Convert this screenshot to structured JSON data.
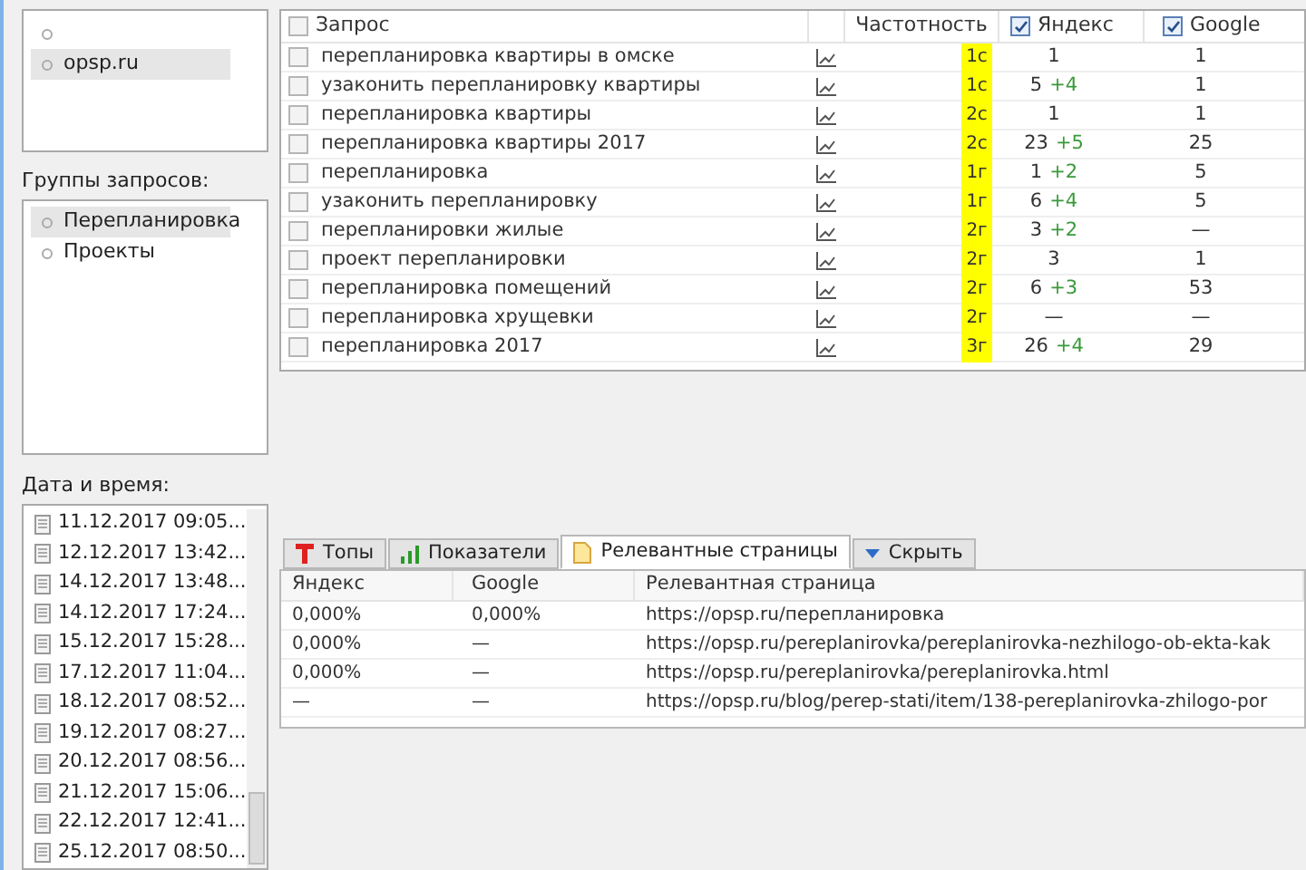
{
  "projects": {
    "items": [
      {
        "selected": false
      },
      {
        "label": "opsp.ru",
        "selected": true
      }
    ]
  },
  "groups": {
    "label": "Группы запросов:",
    "items": [
      {
        "label": "Перепланировка",
        "selected": true
      },
      {
        "label": "Проекты",
        "selected": false
      }
    ]
  },
  "dates": {
    "label": "Дата и время:",
    "items": [
      "11.12.2017 09:05...",
      "12.12.2017 13:42...",
      "14.12.2017 13:48...",
      "14.12.2017 17:24...",
      "15.12.2017 15:28...",
      "17.12.2017 11:04...",
      "18.12.2017 08:52...",
      "19.12.2017 08:27...",
      "20.12.2017 08:56...",
      "21.12.2017 15:06...",
      "22.12.2017 12:41...",
      "25.12.2017 08:50..."
    ]
  },
  "queries": {
    "columns": [
      {
        "label": "Запрос",
        "kind": "checkbox",
        "checked": false
      },
      {
        "label": "Частотность",
        "kind": "plain"
      },
      {
        "label": "Яндекс",
        "kind": "checkbox",
        "checked": true
      },
      {
        "label": "Google",
        "kind": "checkbox",
        "checked": true
      }
    ],
    "rows": [
      {
        "query": "перепланировка квартиры в омске",
        "checked": false,
        "badge": "1с",
        "yandex": "1",
        "delta": "",
        "google": "1"
      },
      {
        "query": "узаконить перепланировку квартиры",
        "checked": false,
        "badge": "1с",
        "yandex": "5",
        "delta": "+4",
        "google": "1"
      },
      {
        "query": "перепланировка квартиры",
        "checked": false,
        "badge": "2с",
        "yandex": "1",
        "delta": "",
        "google": "1"
      },
      {
        "query": "перепланировка квартиры 2017",
        "checked": false,
        "badge": "2с",
        "yandex": "23",
        "delta": "+5",
        "google": "25"
      },
      {
        "query": "перепланировка",
        "checked": false,
        "badge": "1г",
        "yandex": "1",
        "delta": "+2",
        "google": "5"
      },
      {
        "query": "узаконить перепланировку",
        "checked": false,
        "badge": "1г",
        "yandex": "6",
        "delta": "+4",
        "google": "5"
      },
      {
        "query": "перепланировки жилые",
        "checked": false,
        "badge": "2г",
        "yandex": "3",
        "delta": "+2",
        "google": "—"
      },
      {
        "query": "проект перепланировки",
        "checked": false,
        "badge": "2г",
        "yandex": "3",
        "delta": "",
        "google": "1"
      },
      {
        "query": "перепланировка помещений",
        "checked": false,
        "badge": "2г",
        "yandex": "6",
        "delta": "+3",
        "google": "53"
      },
      {
        "query": "перепланировка хрущевки",
        "checked": false,
        "badge": "2г",
        "yandex": "—",
        "delta": "",
        "google": "—"
      },
      {
        "query": "перепланировка 2017",
        "checked": false,
        "badge": "3г",
        "yandex": "26",
        "delta": "+4",
        "google": "29"
      }
    ]
  },
  "tabs": [
    {
      "label": "Топы",
      "kind": "tops",
      "selected": false
    },
    {
      "label": "Показатели",
      "kind": "stats",
      "selected": false
    },
    {
      "label": "Релевантные страницы",
      "kind": "pages",
      "selected": true
    },
    {
      "label": "Скрыть",
      "kind": "hide",
      "selected": false
    }
  ],
  "pages": {
    "columns": [
      "Яндекс",
      "Google",
      "Релевантная страница"
    ],
    "rows": [
      [
        "0,000%",
        "0,000%",
        "https://opsp.ru/перепланировка"
      ],
      [
        "0,000%",
        "—",
        "https://opsp.ru/pereplanirovka/pereplanirovka-nezhilogo-ob-ekta-kak"
      ],
      [
        "0,000%",
        "—",
        "https://opsp.ru/pereplanirovka/pereplanirovka.html"
      ],
      [
        "—",
        "—",
        "https://opsp.ru/blog/perep-stati/item/138-pereplanirovka-zhilogo-por"
      ]
    ]
  }
}
